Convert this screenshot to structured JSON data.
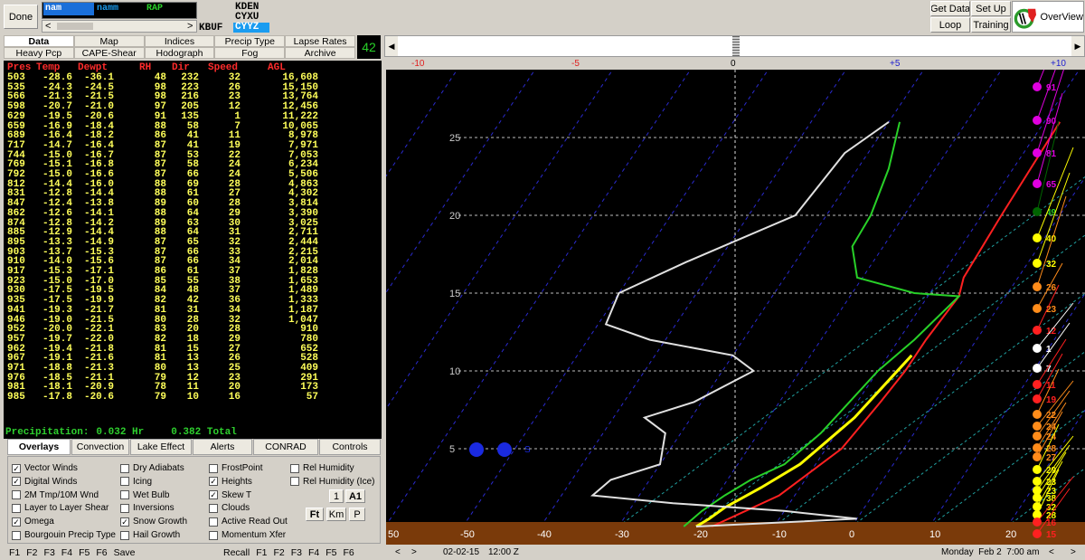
{
  "toolbar": {
    "done_label": "Done",
    "models": {
      "row1": [
        "nam",
        "namm",
        "RAP"
      ]
    },
    "stations": [
      "KDEN",
      "CYXU",
      "CYYZ"
    ],
    "station_left": "KBUF",
    "nav_left": "<",
    "nav_right": ">",
    "get_data": "Get Data",
    "set_up": "Set Up",
    "loop": "Loop",
    "training": "Training",
    "overview": "OverView",
    "counter": "42"
  },
  "tabs_row1": [
    "Data",
    "Map",
    "Indices",
    "Precip Type",
    "Lapse Rates"
  ],
  "tabs_row2": [
    "Heavy Pcp",
    "CAPE-Shear",
    "Hodograph",
    "Fog",
    "Archive"
  ],
  "table": {
    "headers": [
      "Pres",
      "Temp",
      "Dewpt",
      "RH",
      "Dir",
      "Speed",
      "AGL"
    ],
    "rows": [
      [
        "503",
        "-28.6",
        "-36.1",
        "48",
        "232",
        "32",
        "16,608"
      ],
      [
        "535",
        "-24.3",
        "-24.5",
        "98",
        "223",
        "26",
        "15,150"
      ],
      [
        "566",
        "-21.3",
        "-21.5",
        "98",
        "216",
        "23",
        "13,764"
      ],
      [
        "598",
        "-20.7",
        "-21.0",
        "97",
        "205",
        "12",
        "12,456"
      ],
      [
        "629",
        "-19.5",
        "-20.6",
        "91",
        "135",
        "1",
        "11,222"
      ],
      [
        "659",
        "-16.9",
        "-18.4",
        "88",
        "58",
        "7",
        "10,065"
      ],
      [
        "689",
        "-16.4",
        "-18.2",
        "86",
        "41",
        "11",
        "8,978"
      ],
      [
        "717",
        "-14.7",
        "-16.4",
        "87",
        "41",
        "19",
        "7,971"
      ],
      [
        "744",
        "-15.0",
        "-16.7",
        "87",
        "53",
        "22",
        "7,053"
      ],
      [
        "769",
        "-15.1",
        "-16.8",
        "87",
        "58",
        "24",
        "6,234"
      ],
      [
        "792",
        "-15.0",
        "-16.6",
        "87",
        "66",
        "24",
        "5,506"
      ],
      [
        "812",
        "-14.4",
        "-16.0",
        "88",
        "69",
        "28",
        "4,863"
      ],
      [
        "831",
        "-12.8",
        "-14.4",
        "88",
        "61",
        "27",
        "4,302"
      ],
      [
        "847",
        "-12.4",
        "-13.8",
        "89",
        "60",
        "28",
        "3,814"
      ],
      [
        "862",
        "-12.6",
        "-14.1",
        "88",
        "64",
        "29",
        "3,390"
      ],
      [
        "874",
        "-12.8",
        "-14.2",
        "89",
        "63",
        "30",
        "3,025"
      ],
      [
        "885",
        "-12.9",
        "-14.4",
        "88",
        "64",
        "31",
        "2,711"
      ],
      [
        "895",
        "-13.3",
        "-14.9",
        "87",
        "65",
        "32",
        "2,444"
      ],
      [
        "903",
        "-13.7",
        "-15.3",
        "87",
        "66",
        "33",
        "2,215"
      ],
      [
        "910",
        "-14.0",
        "-15.6",
        "87",
        "66",
        "34",
        "2,014"
      ],
      [
        "917",
        "-15.3",
        "-17.1",
        "86",
        "61",
        "37",
        "1,828"
      ],
      [
        "923",
        "-15.0",
        "-17.0",
        "85",
        "55",
        "38",
        "1,653"
      ],
      [
        "930",
        "-17.5",
        "-19.5",
        "84",
        "48",
        "37",
        "1,489"
      ],
      [
        "935",
        "-17.5",
        "-19.9",
        "82",
        "42",
        "36",
        "1,333"
      ],
      [
        "941",
        "-19.3",
        "-21.7",
        "81",
        "31",
        "34",
        "1,187"
      ],
      [
        "946",
        "-19.0",
        "-21.5",
        "80",
        "28",
        "32",
        "1,047"
      ],
      [
        "952",
        "-20.0",
        "-22.1",
        "83",
        "20",
        "28",
        "910"
      ],
      [
        "957",
        "-19.7",
        "-22.0",
        "82",
        "18",
        "29",
        "780"
      ],
      [
        "962",
        "-19.4",
        "-21.8",
        "81",
        "15",
        "27",
        "652"
      ],
      [
        "967",
        "-19.1",
        "-21.6",
        "81",
        "13",
        "26",
        "528"
      ],
      [
        "971",
        "-18.8",
        "-21.3",
        "80",
        "13",
        "25",
        "409"
      ],
      [
        "976",
        "-18.5",
        "-21.1",
        "79",
        "12",
        "23",
        "291"
      ],
      [
        "981",
        "-18.1",
        "-20.9",
        "78",
        "11",
        "20",
        "173"
      ],
      [
        "985",
        "-17.8",
        "-20.6",
        "79",
        "10",
        "16",
        "57"
      ]
    ],
    "precip_label": "Precipitation:",
    "precip_hr": "0.032 Hr",
    "precip_total": "0.382 Total"
  },
  "overlay_tabs": [
    "Overlays",
    "Convection",
    "Lake Effect",
    "Alerts",
    "CONRAD",
    "Controls"
  ],
  "checkboxes": {
    "col1": [
      {
        "label": "Vector Winds",
        "checked": true
      },
      {
        "label": "Digital Winds",
        "checked": true
      },
      {
        "label": "2M Tmp/10M Wnd",
        "checked": false
      },
      {
        "label": "Layer to Layer Shear",
        "checked": false
      },
      {
        "label": "Omega",
        "checked": true
      },
      {
        "label": "Bourgouin Precip Type",
        "checked": false
      }
    ],
    "col2": [
      {
        "label": "Dry Adiabats",
        "checked": false
      },
      {
        "label": "Icing",
        "checked": false
      },
      {
        "label": "Wet Bulb",
        "checked": false
      },
      {
        "label": "Inversions",
        "checked": false
      },
      {
        "label": "Snow Growth",
        "checked": true
      },
      {
        "label": "Hail Growth",
        "checked": false
      }
    ],
    "col3": [
      {
        "label": "FrostPoint",
        "checked": false
      },
      {
        "label": "Heights",
        "checked": true
      },
      {
        "label": "Skew T",
        "checked": true
      },
      {
        "label": "Clouds",
        "checked": false
      },
      {
        "label": "Active Read Out",
        "checked": false
      },
      {
        "label": "Momentum Xfer",
        "checked": false
      }
    ],
    "col4": [
      {
        "label": "Rel Humidity",
        "checked": false
      },
      {
        "label": "Rel Humidity (Ice)",
        "checked": false
      }
    ]
  },
  "small_buttons": [
    "1",
    "A1",
    "Ft",
    "Km",
    "P"
  ],
  "fkeys_left": [
    "F1",
    "F2",
    "F3",
    "F4",
    "F5",
    "F6",
    "Save"
  ],
  "fkeys_right": [
    "Recall",
    "F1",
    "F2",
    "F3",
    "F4",
    "F5",
    "F6"
  ],
  "status": {
    "date": "02-02-15",
    "time": "12:00 Z",
    "nav_prev": "<",
    "nav_next": ">",
    "local": "Monday  Feb 2  7:00 am"
  },
  "chart_data": {
    "type": "line",
    "title": "",
    "temp_axis_ticks": [
      "50",
      "-50",
      "-40",
      "-30",
      "-20",
      "-10",
      "0",
      "10",
      "20"
    ],
    "height_axis_ticks": [
      "25",
      "20",
      "15",
      "10",
      "5"
    ],
    "omega_scale_ticks": [
      "-10",
      "-5",
      "0",
      "+5",
      "+10"
    ],
    "wind_levels": [
      "91",
      "90",
      "81",
      "65",
      "49",
      "40",
      "32",
      "26",
      "23",
      "12",
      "1",
      "7",
      "11",
      "19",
      "22",
      "24",
      "24",
      "28",
      "27",
      "29",
      "23",
      "23",
      "38",
      "32",
      "28",
      "16",
      "15"
    ],
    "wind_level_colors": [
      "#e000e0",
      "#e000e0",
      "#e000e0",
      "#e000e0",
      "#006400",
      "#ffff00",
      "#ffff00",
      "#ff8c1a",
      "#ff8c1a",
      "#ff2020",
      "#ffffff",
      "#ffffff",
      "#ff2020",
      "#ff2020",
      "#ff8c1a",
      "#ff8c1a",
      "#ff8c1a",
      "#ff8c1a",
      "#ff8c1a",
      "#ffff00",
      "#ffff00",
      "#ffff00",
      "#ffff00",
      "#ffff00",
      "#ffff00",
      "#ff2020",
      "#ff2020"
    ],
    "blue_marker_label": "S",
    "series": [
      {
        "name": "",
        "color": "#ff2020",
        "points": [
          [
            -8,
            26
          ],
          [
            -7.5,
            20
          ],
          [
            -7,
            16
          ],
          [
            -6,
            14.8
          ],
          [
            -6.5,
            12
          ],
          [
            -6.5,
            10
          ],
          [
            -7,
            8
          ],
          [
            -8,
            5
          ],
          [
            -12,
            2
          ],
          [
            -15,
            1
          ],
          [
            -18,
            0
          ]
        ]
      },
      {
        "name": "",
        "color": "#28d028",
        "points": [
          [
            -28.6,
            26
          ],
          [
            -26,
            23
          ],
          [
            -24.3,
            20
          ],
          [
            -24,
            18
          ],
          [
            -20.7,
            16
          ],
          [
            -12,
            15
          ],
          [
            -6,
            14.8
          ],
          [
            -8,
            12
          ],
          [
            -10,
            10
          ],
          [
            -11,
            8
          ],
          [
            -12,
            6
          ],
          [
            -14,
            4
          ],
          [
            -17,
            3
          ],
          [
            -19,
            2
          ],
          [
            -20.6,
            1
          ],
          [
            -21.6,
            0
          ]
        ]
      },
      {
        "name": "",
        "color": "#ffff00",
        "points": [
          [
            -7,
            11
          ],
          [
            -8,
            9
          ],
          [
            -9,
            7
          ],
          [
            -10,
            6
          ],
          [
            -12,
            4
          ],
          [
            -15,
            2.5
          ],
          [
            -18,
            1.2
          ],
          [
            -19,
            0.5
          ],
          [
            -20,
            0
          ]
        ]
      },
      {
        "name": "",
        "color": "#e0e0e0",
        "points": [
          [
            -30,
            26
          ],
          [
            -33,
            24
          ],
          [
            -34,
            20
          ],
          [
            -44,
            17
          ],
          [
            -50,
            15
          ],
          [
            -49,
            13
          ],
          [
            -42,
            12
          ],
          [
            -30,
            11
          ],
          [
            -26,
            10
          ],
          [
            -31,
            8
          ],
          [
            -36,
            7
          ],
          [
            -32,
            6
          ],
          [
            -30,
            4
          ],
          [
            -35,
            3
          ],
          [
            -36,
            2
          ],
          [
            -25,
            1.5
          ],
          [
            -10,
            1
          ],
          [
            0,
            0.5
          ],
          [
            -20,
            0
          ]
        ]
      }
    ]
  }
}
